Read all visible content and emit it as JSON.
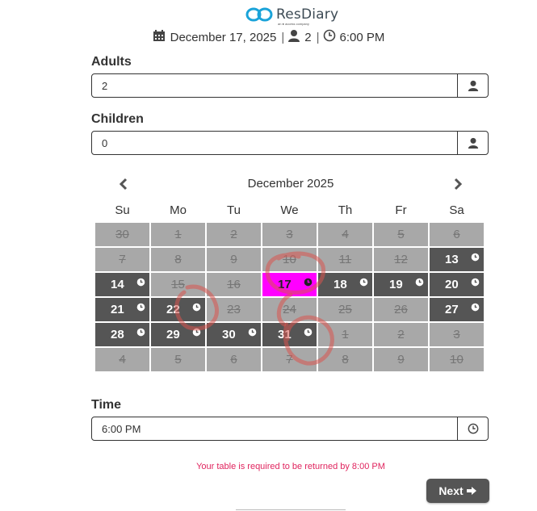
{
  "brand": {
    "name": "ResDiary",
    "subtitle": "an ● access company"
  },
  "summary": {
    "date": "December 17, 2025",
    "guests": "2",
    "time": "6:00 PM"
  },
  "form": {
    "adults_label": "Adults",
    "adults_value": "2",
    "children_label": "Children",
    "children_value": "0",
    "time_label": "Time",
    "time_value": "6:00 PM"
  },
  "calendar": {
    "title": "December 2025",
    "weekdays": [
      "Su",
      "Mo",
      "Tu",
      "We",
      "Th",
      "Fr",
      "Sa"
    ],
    "weeks": [
      [
        {
          "d": "30",
          "s": "out"
        },
        {
          "d": "1",
          "s": "out"
        },
        {
          "d": "2",
          "s": "out"
        },
        {
          "d": "3",
          "s": "out"
        },
        {
          "d": "4",
          "s": "out"
        },
        {
          "d": "5",
          "s": "out"
        },
        {
          "d": "6",
          "s": "out"
        }
      ],
      [
        {
          "d": "7",
          "s": "out"
        },
        {
          "d": "8",
          "s": "out"
        },
        {
          "d": "9",
          "s": "out"
        },
        {
          "d": "10",
          "s": "out"
        },
        {
          "d": "11",
          "s": "out"
        },
        {
          "d": "12",
          "s": "out"
        },
        {
          "d": "13",
          "s": "avail"
        }
      ],
      [
        {
          "d": "14",
          "s": "avail"
        },
        {
          "d": "15",
          "s": "out"
        },
        {
          "d": "16",
          "s": "out"
        },
        {
          "d": "17",
          "s": "sel"
        },
        {
          "d": "18",
          "s": "avail"
        },
        {
          "d": "19",
          "s": "avail"
        },
        {
          "d": "20",
          "s": "avail"
        }
      ],
      [
        {
          "d": "21",
          "s": "avail"
        },
        {
          "d": "22",
          "s": "avail"
        },
        {
          "d": "23",
          "s": "out"
        },
        {
          "d": "24",
          "s": "out"
        },
        {
          "d": "25",
          "s": "out"
        },
        {
          "d": "26",
          "s": "out"
        },
        {
          "d": "27",
          "s": "avail"
        }
      ],
      [
        {
          "d": "28",
          "s": "avail"
        },
        {
          "d": "29",
          "s": "avail"
        },
        {
          "d": "30",
          "s": "avail"
        },
        {
          "d": "31",
          "s": "avail"
        },
        {
          "d": "1",
          "s": "out"
        },
        {
          "d": "2",
          "s": "out"
        },
        {
          "d": "3",
          "s": "out"
        }
      ],
      [
        {
          "d": "4",
          "s": "out"
        },
        {
          "d": "5",
          "s": "out"
        },
        {
          "d": "6",
          "s": "out"
        },
        {
          "d": "7",
          "s": "out"
        },
        {
          "d": "8",
          "s": "out"
        },
        {
          "d": "9",
          "s": "out"
        },
        {
          "d": "10",
          "s": "out"
        }
      ]
    ]
  },
  "note": "Your table is required to be returned by 8:00 PM",
  "next_label": "Next",
  "colors": {
    "accent": "#e0245e",
    "selected": "#ff00ff",
    "available": "#555555",
    "unavailable": "#a8a8a8",
    "logo": "#1aa3d9"
  }
}
